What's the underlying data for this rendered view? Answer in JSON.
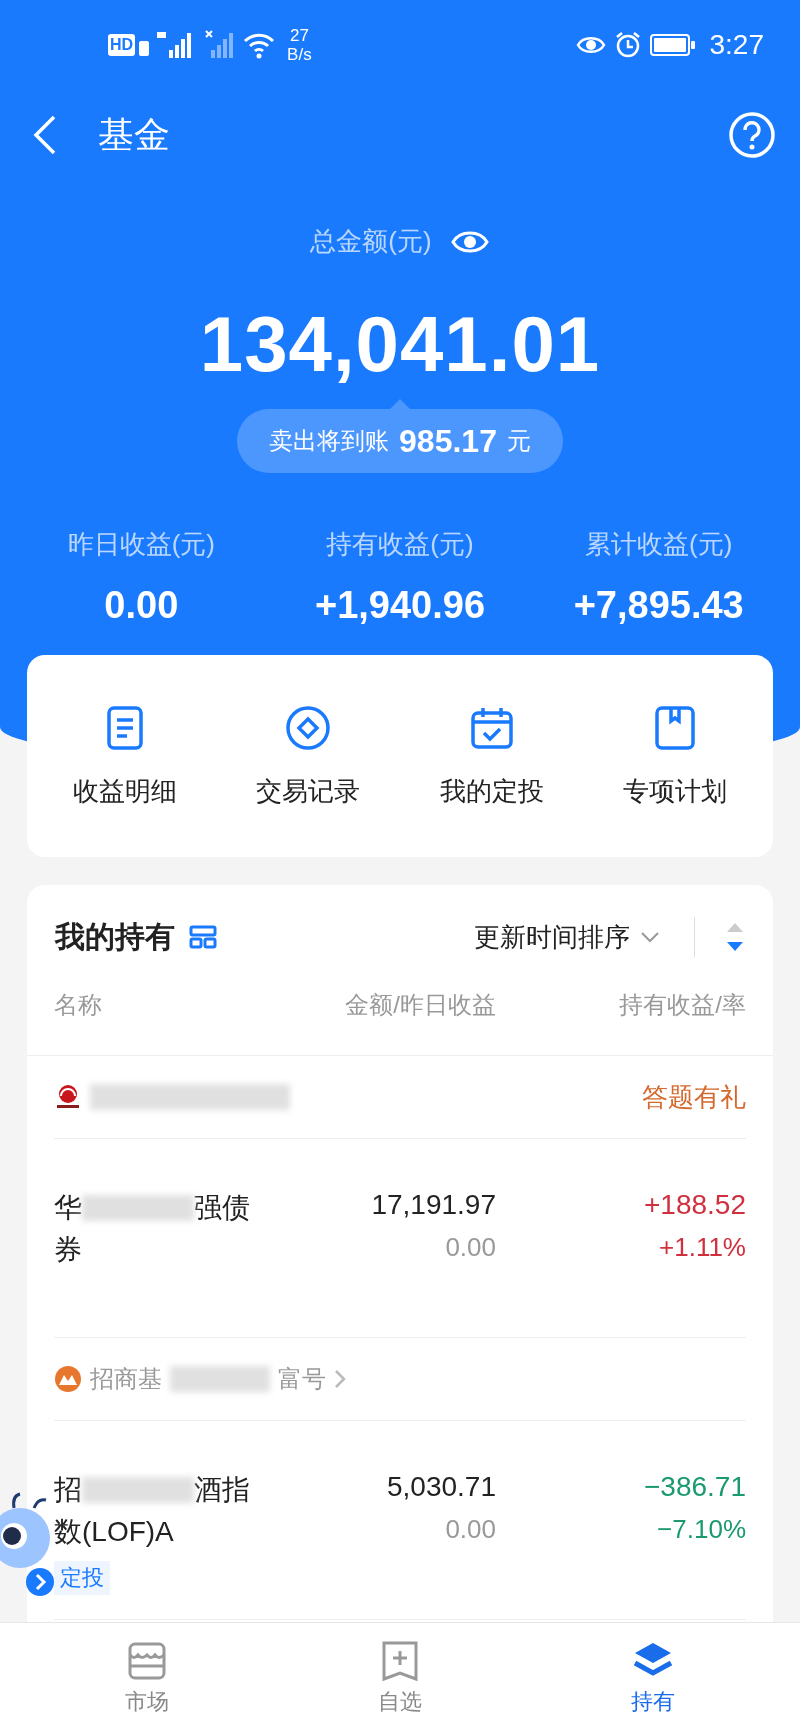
{
  "status_bar": {
    "hd_label": "HD",
    "network_speed": "27",
    "network_speed_unit": "B/s",
    "time": "3:27"
  },
  "header": {
    "title": "基金"
  },
  "summary": {
    "total_label": "总金额(元)",
    "total": "134,041.01",
    "pending_label": "卖出将到账",
    "pending_amount": "985.17",
    "pending_unit": "元",
    "stats": [
      {
        "label": "昨日收益(元)",
        "value": "0.00"
      },
      {
        "label": "持有收益(元)",
        "value": "+1,940.96"
      },
      {
        "label": "累计收益(元)",
        "value": "+7,895.43"
      }
    ]
  },
  "quick_actions": [
    {
      "label": "收益明细",
      "kind": "document"
    },
    {
      "label": "交易记录",
      "kind": "diamond"
    },
    {
      "label": "我的定投",
      "kind": "calendar"
    },
    {
      "label": "专项计划",
      "kind": "bookmark"
    }
  ],
  "holdings": {
    "title": "我的持有",
    "sort_label": "更新时间排序",
    "columns": [
      "名称",
      "金额/昨日收益",
      "持有收益/率"
    ],
    "groups": [
      {
        "source": {
          "kind": "sun",
          "link": false,
          "badge": "答题有礼"
        },
        "fund": {
          "name_start": "华",
          "name_mid": "强债",
          "name_end": "券",
          "amount": "17,191.97",
          "yesterday": "0.00",
          "profit": "+188.52",
          "rate": "+1.11%",
          "kind": "gain"
        }
      },
      {
        "source": {
          "kind": "mountain",
          "name_start": "招商基",
          "name_end": "富号",
          "link": true
        },
        "fund": {
          "name_start": "招",
          "name_mid": "酒指",
          "name_end": "数(LOF)A",
          "amount": "5,030.71",
          "yesterday": "0.00",
          "profit": "−386.71",
          "rate": "−7.10%",
          "kind": "loss",
          "tag": "定投"
        }
      }
    ]
  },
  "tabs": [
    {
      "label": "市场",
      "kind": "store",
      "selected": false
    },
    {
      "label": "自选",
      "kind": "add",
      "selected": false
    },
    {
      "label": "持有",
      "kind": "layers",
      "selected": true
    }
  ]
}
